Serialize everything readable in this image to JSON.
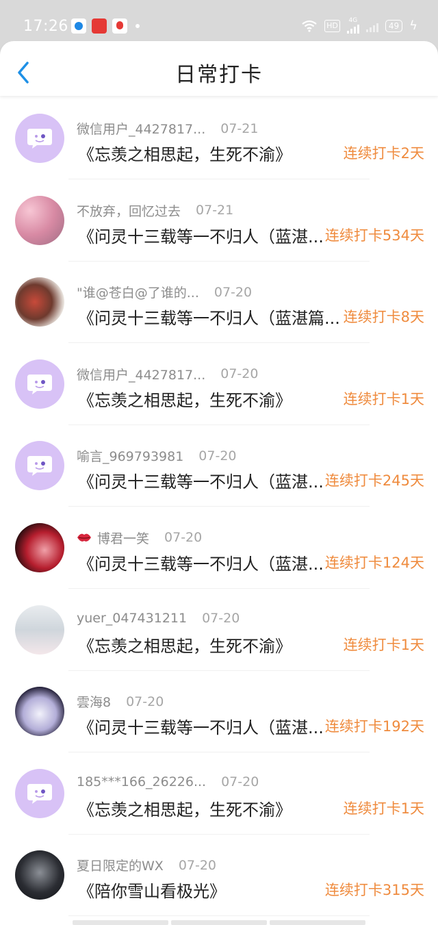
{
  "status_bar": {
    "time": "17:26",
    "hd": "HD",
    "network": "4G",
    "battery": "49"
  },
  "header": {
    "title": "日常打卡",
    "back_icon": "chevron-left-icon"
  },
  "colors": {
    "accent": "#1e90e6",
    "streak": "#ef8b3e",
    "default_avatar": "#d8c2f6"
  },
  "entries": [
    {
      "user": "微信用户_4427817...",
      "date": "07-21",
      "content": "《忘羡之相思起，生死不渝》",
      "streak": "连续打卡2天",
      "avatar": "default"
    },
    {
      "user": "不放弃，回忆过去",
      "date": "07-21",
      "content": "《问灵十三载等一不归人（蓝湛...",
      "streak": "连续打卡534天",
      "avatar": "photo1"
    },
    {
      "user": "\"谁@苍白@了谁的...",
      "date": "07-20",
      "content": "《问灵十三载等一不归人（蓝湛篇...",
      "streak": "连续打卡8天",
      "avatar": "photo2"
    },
    {
      "user": "微信用户_4427817...",
      "date": "07-20",
      "content": "《忘羡之相思起，生死不渝》",
      "streak": "连续打卡1天",
      "avatar": "default"
    },
    {
      "user": "喻言_969793981",
      "date": "07-20",
      "content": "《问灵十三载等一不归人（蓝湛...",
      "streak": "连续打卡245天",
      "avatar": "default"
    },
    {
      "user": "博君一笑",
      "date": "07-20",
      "content": "《问灵十三载等一不归人（蓝湛...",
      "streak": "连续打卡124天",
      "avatar": "photo3",
      "has_lips": true
    },
    {
      "user": "yuer_047431211",
      "date": "07-20",
      "content": "《忘羡之相思起，生死不渝》",
      "streak": "连续打卡1天",
      "avatar": "photo4"
    },
    {
      "user": "雲海8",
      "date": "07-20",
      "content": "《问灵十三载等一不归人（蓝湛...",
      "streak": "连续打卡192天",
      "avatar": "photo5"
    },
    {
      "user": "185***166_26226...",
      "date": "07-20",
      "content": "《忘羡之相思起，生死不渝》",
      "streak": "连续打卡1天",
      "avatar": "default"
    },
    {
      "user": "夏日限定的WX",
      "date": "07-20",
      "content": "《陪你雪山看极光》",
      "streak": "连续打卡315天",
      "avatar": "photo6"
    }
  ]
}
